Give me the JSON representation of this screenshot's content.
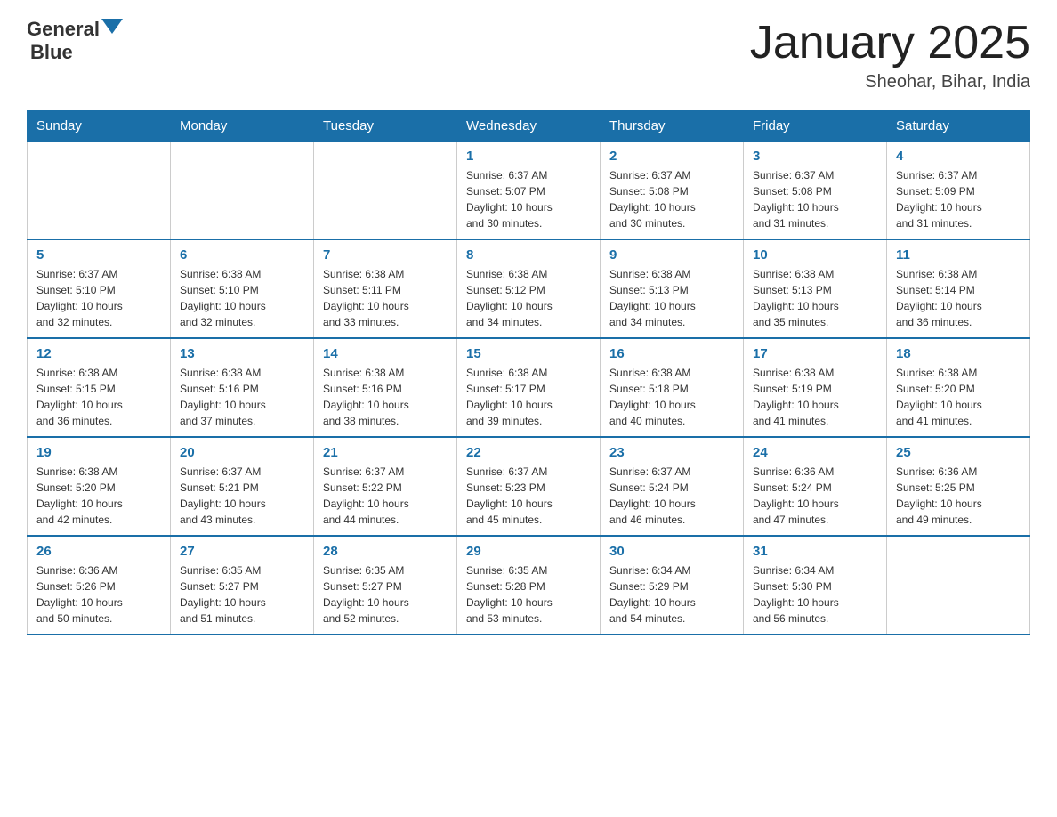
{
  "header": {
    "logo_general": "General",
    "logo_blue": "Blue",
    "title": "January 2025",
    "subtitle": "Sheohar, Bihar, India"
  },
  "weekdays": [
    "Sunday",
    "Monday",
    "Tuesday",
    "Wednesday",
    "Thursday",
    "Friday",
    "Saturday"
  ],
  "weeks": [
    [
      {
        "day": "",
        "info": ""
      },
      {
        "day": "",
        "info": ""
      },
      {
        "day": "",
        "info": ""
      },
      {
        "day": "1",
        "info": "Sunrise: 6:37 AM\nSunset: 5:07 PM\nDaylight: 10 hours\nand 30 minutes."
      },
      {
        "day": "2",
        "info": "Sunrise: 6:37 AM\nSunset: 5:08 PM\nDaylight: 10 hours\nand 30 minutes."
      },
      {
        "day": "3",
        "info": "Sunrise: 6:37 AM\nSunset: 5:08 PM\nDaylight: 10 hours\nand 31 minutes."
      },
      {
        "day": "4",
        "info": "Sunrise: 6:37 AM\nSunset: 5:09 PM\nDaylight: 10 hours\nand 31 minutes."
      }
    ],
    [
      {
        "day": "5",
        "info": "Sunrise: 6:37 AM\nSunset: 5:10 PM\nDaylight: 10 hours\nand 32 minutes."
      },
      {
        "day": "6",
        "info": "Sunrise: 6:38 AM\nSunset: 5:10 PM\nDaylight: 10 hours\nand 32 minutes."
      },
      {
        "day": "7",
        "info": "Sunrise: 6:38 AM\nSunset: 5:11 PM\nDaylight: 10 hours\nand 33 minutes."
      },
      {
        "day": "8",
        "info": "Sunrise: 6:38 AM\nSunset: 5:12 PM\nDaylight: 10 hours\nand 34 minutes."
      },
      {
        "day": "9",
        "info": "Sunrise: 6:38 AM\nSunset: 5:13 PM\nDaylight: 10 hours\nand 34 minutes."
      },
      {
        "day": "10",
        "info": "Sunrise: 6:38 AM\nSunset: 5:13 PM\nDaylight: 10 hours\nand 35 minutes."
      },
      {
        "day": "11",
        "info": "Sunrise: 6:38 AM\nSunset: 5:14 PM\nDaylight: 10 hours\nand 36 minutes."
      }
    ],
    [
      {
        "day": "12",
        "info": "Sunrise: 6:38 AM\nSunset: 5:15 PM\nDaylight: 10 hours\nand 36 minutes."
      },
      {
        "day": "13",
        "info": "Sunrise: 6:38 AM\nSunset: 5:16 PM\nDaylight: 10 hours\nand 37 minutes."
      },
      {
        "day": "14",
        "info": "Sunrise: 6:38 AM\nSunset: 5:16 PM\nDaylight: 10 hours\nand 38 minutes."
      },
      {
        "day": "15",
        "info": "Sunrise: 6:38 AM\nSunset: 5:17 PM\nDaylight: 10 hours\nand 39 minutes."
      },
      {
        "day": "16",
        "info": "Sunrise: 6:38 AM\nSunset: 5:18 PM\nDaylight: 10 hours\nand 40 minutes."
      },
      {
        "day": "17",
        "info": "Sunrise: 6:38 AM\nSunset: 5:19 PM\nDaylight: 10 hours\nand 41 minutes."
      },
      {
        "day": "18",
        "info": "Sunrise: 6:38 AM\nSunset: 5:20 PM\nDaylight: 10 hours\nand 41 minutes."
      }
    ],
    [
      {
        "day": "19",
        "info": "Sunrise: 6:38 AM\nSunset: 5:20 PM\nDaylight: 10 hours\nand 42 minutes."
      },
      {
        "day": "20",
        "info": "Sunrise: 6:37 AM\nSunset: 5:21 PM\nDaylight: 10 hours\nand 43 minutes."
      },
      {
        "day": "21",
        "info": "Sunrise: 6:37 AM\nSunset: 5:22 PM\nDaylight: 10 hours\nand 44 minutes."
      },
      {
        "day": "22",
        "info": "Sunrise: 6:37 AM\nSunset: 5:23 PM\nDaylight: 10 hours\nand 45 minutes."
      },
      {
        "day": "23",
        "info": "Sunrise: 6:37 AM\nSunset: 5:24 PM\nDaylight: 10 hours\nand 46 minutes."
      },
      {
        "day": "24",
        "info": "Sunrise: 6:36 AM\nSunset: 5:24 PM\nDaylight: 10 hours\nand 47 minutes."
      },
      {
        "day": "25",
        "info": "Sunrise: 6:36 AM\nSunset: 5:25 PM\nDaylight: 10 hours\nand 49 minutes."
      }
    ],
    [
      {
        "day": "26",
        "info": "Sunrise: 6:36 AM\nSunset: 5:26 PM\nDaylight: 10 hours\nand 50 minutes."
      },
      {
        "day": "27",
        "info": "Sunrise: 6:35 AM\nSunset: 5:27 PM\nDaylight: 10 hours\nand 51 minutes."
      },
      {
        "day": "28",
        "info": "Sunrise: 6:35 AM\nSunset: 5:27 PM\nDaylight: 10 hours\nand 52 minutes."
      },
      {
        "day": "29",
        "info": "Sunrise: 6:35 AM\nSunset: 5:28 PM\nDaylight: 10 hours\nand 53 minutes."
      },
      {
        "day": "30",
        "info": "Sunrise: 6:34 AM\nSunset: 5:29 PM\nDaylight: 10 hours\nand 54 minutes."
      },
      {
        "day": "31",
        "info": "Sunrise: 6:34 AM\nSunset: 5:30 PM\nDaylight: 10 hours\nand 56 minutes."
      },
      {
        "day": "",
        "info": ""
      }
    ]
  ]
}
